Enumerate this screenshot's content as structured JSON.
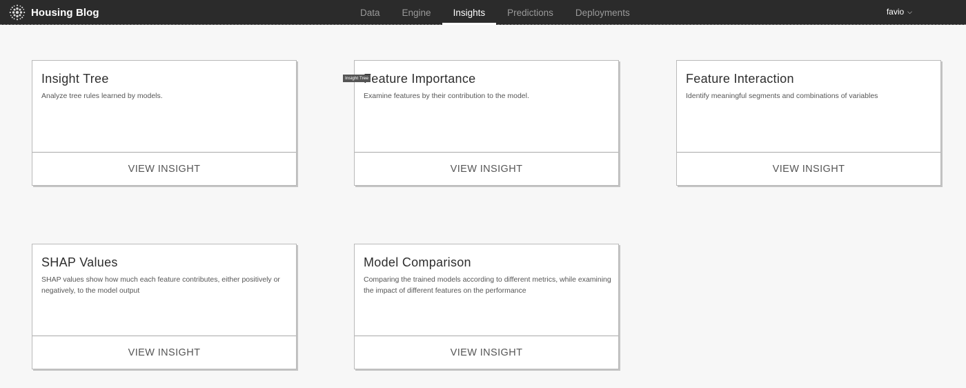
{
  "header": {
    "app_name": "Housing Blog",
    "logo_icon": "dotted-sphere-logo-icon",
    "nav": [
      {
        "label": "Data"
      },
      {
        "label": "Engine"
      },
      {
        "label": "Insights",
        "active": true
      },
      {
        "label": "Predictions"
      },
      {
        "label": "Deployments"
      }
    ],
    "user": {
      "name": "favio",
      "icon": "chevron-down-icon"
    }
  },
  "tooltip": {
    "text": "Insight Tree"
  },
  "cards": [
    {
      "title": "Insight Tree",
      "description": "Analyze tree rules learned by models.",
      "button": "VIEW INSIGHT"
    },
    {
      "title": "Feature Importance",
      "description": "Examine features by their contribution to the model.",
      "button": "VIEW INSIGHT"
    },
    {
      "title": "Feature Interaction",
      "description": "Identify meaningful segments and combinations of variables",
      "button": "VIEW INSIGHT"
    },
    {
      "title": "SHAP Values",
      "description": "SHAP values show how much each feature contributes, either positively or negatively, to the model output",
      "button": "VIEW INSIGHT"
    },
    {
      "title": "Model Comparison",
      "description": "Comparing the trained models according to different metrics, while examining the impact of different features on the performance",
      "button": "VIEW INSIGHT"
    }
  ],
  "colors": {
    "topbar": "#2b2b2b",
    "background": "#f7f7f7",
    "card": "#ffffff"
  }
}
